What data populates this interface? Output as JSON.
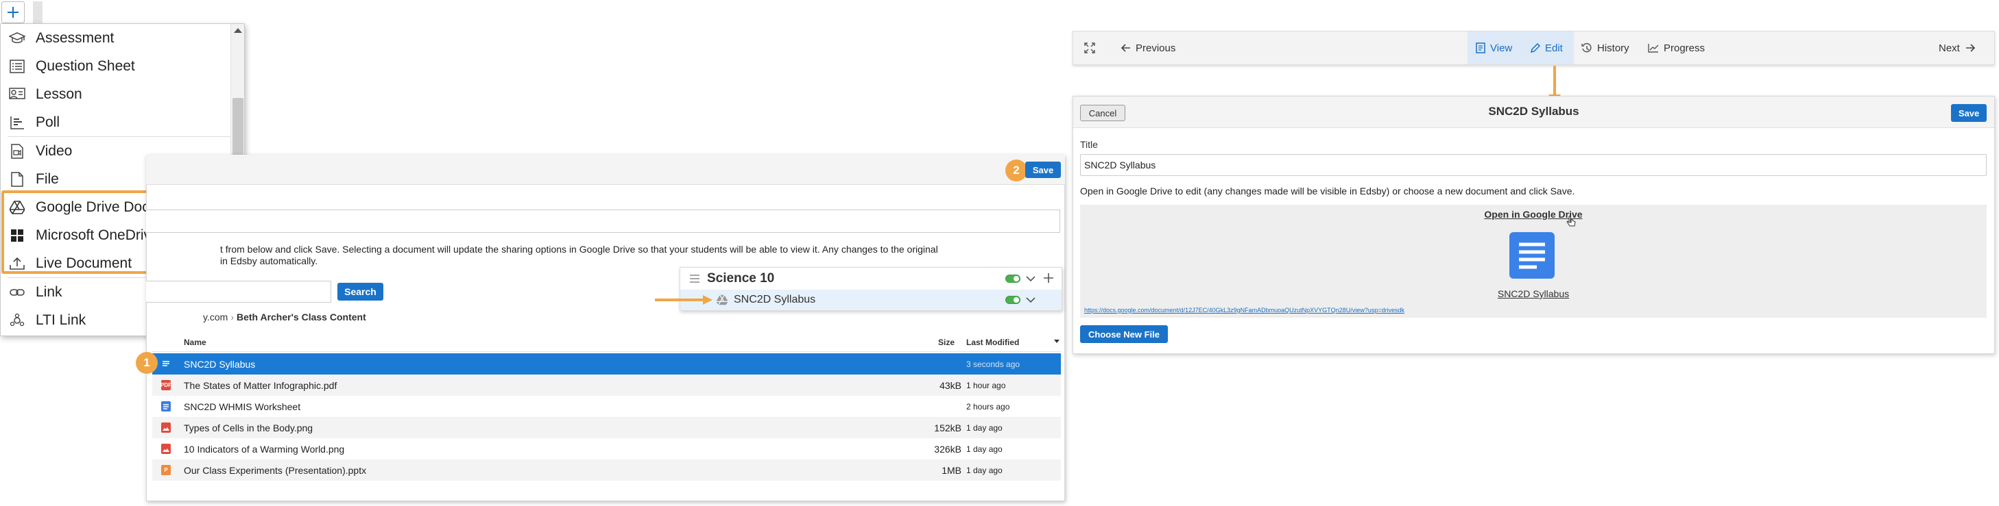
{
  "colors": {
    "accent": "#1a73c8",
    "highlight": "#f0a646",
    "selected_row": "#1b7bd4",
    "toggle_on": "#4caf50"
  },
  "add_menu": {
    "plus_icon": "plus-icon",
    "items": [
      {
        "label": "Assessment",
        "icon": "graduation-cap-icon"
      },
      {
        "label": "Question Sheet",
        "icon": "list-icon"
      },
      {
        "label": "Lesson",
        "icon": "lesson-icon"
      },
      {
        "label": "Poll",
        "icon": "poll-icon"
      },
      {
        "label": "Video",
        "icon": "video-icon"
      },
      {
        "label": "File",
        "icon": "file-icon"
      },
      {
        "label": "Google Drive Document",
        "icon": "google-drive-icon"
      },
      {
        "label": "Microsoft OneDrive Document",
        "icon": "onedrive-icon"
      },
      {
        "label": "Live Document",
        "icon": "upload-icon"
      },
      {
        "label": "Link",
        "icon": "link-icon"
      },
      {
        "label": "LTI Link",
        "icon": "lti-icon"
      }
    ]
  },
  "picker": {
    "step2_badge": "2",
    "save_label": "Save",
    "description_line1": "t from below and click Save.  Selecting a document will update the sharing options in Google Drive so that your students will be able to view it.  Any changes to the original",
    "description_line2": "in Edsby automatically.",
    "search_label": "Search",
    "breadcrumb_root": "y.com",
    "breadcrumb_current": "Beth Archer's Class Content",
    "columns": {
      "name": "Name",
      "size": "Size",
      "modified": "Last Modified"
    },
    "step1_badge": "1",
    "files": [
      {
        "name": "SNC2D Syllabus",
        "size": "",
        "modified": "3 seconds ago",
        "type": "doc"
      },
      {
        "name": "The States of Matter Infographic.pdf",
        "size": "43kB",
        "modified": "1 hour ago",
        "type": "pdf"
      },
      {
        "name": "SNC2D WHMIS Worksheet",
        "size": "",
        "modified": "2 hours ago",
        "type": "doc"
      },
      {
        "name": "Types of Cells in the Body.png",
        "size": "152kB",
        "modified": "1 day ago",
        "type": "image"
      },
      {
        "name": "10 Indicators of a Warming World.png",
        "size": "326kB",
        "modified": "1 day ago",
        "type": "image"
      },
      {
        "name": "Our Class Experiments (Presentation).pptx",
        "size": "1MB",
        "modified": "1 day ago",
        "type": "slides"
      }
    ]
  },
  "course_card": {
    "title": "Science 10",
    "item": "SNC2D Syllabus"
  },
  "nav": {
    "previous": "Previous",
    "view": "View",
    "edit": "Edit",
    "history": "History",
    "progress": "Progress",
    "next": "Next"
  },
  "editor": {
    "cancel": "Cancel",
    "title": "SNC2D Syllabus",
    "save": "Save",
    "field_label": "Title",
    "field_value": "SNC2D Syllabus",
    "description": "Open in Google Drive to edit (any changes made will be visible in Edsby) or choose a new document and click Save.",
    "open_link": "Open in Google Drive",
    "doc_name": "SNC2D Syllabus",
    "doc_url": "https://docs.google.com/document/d/12J7EC/40GkL3z9gNFamADbmuoaQUzutNpXVYGTQn28U/view?usp=drivesdk",
    "choose_new": "Choose New File"
  }
}
